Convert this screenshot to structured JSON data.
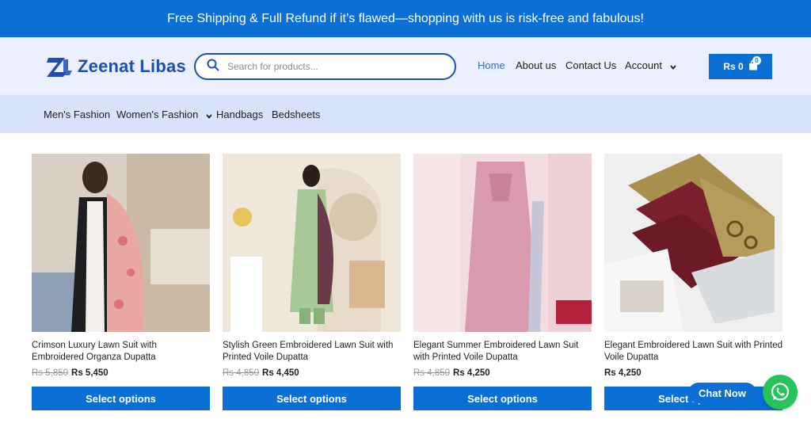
{
  "announcement": "Free Shipping & Full Refund if it’s flawed—shopping with us is risk-free and fabulous!",
  "brand": {
    "name": "Zeenat Libas",
    "color": "#1b4fb5",
    "icon": "zl-logo-icon"
  },
  "search": {
    "placeholder": "Search for products...",
    "value": ""
  },
  "nav": {
    "home": "Home",
    "about": "About us",
    "contact": "Contact Us",
    "account": "Account"
  },
  "cart": {
    "total": "Rs 0",
    "count": "0"
  },
  "categories": {
    "mens": "Men's Fashion",
    "womens": "Women's Fashion",
    "handbags": "Handbags",
    "bedsheets": "Bedsheets"
  },
  "products": [
    {
      "title": "Crimson Luxury Lawn Suit with Embroidered Organza Dupatta",
      "old_price": "Rs 5,850",
      "price": "Rs 5,450",
      "button": "Select options"
    },
    {
      "title": "Stylish Green Embroidered Lawn Suit with Printed Voile Dupatta",
      "old_price": "Rs 4,850",
      "price": "Rs 4,450",
      "button": "Select options"
    },
    {
      "title": "Elegant Summer Embroidered Lawn Suit with Printed Voile Dupatta",
      "old_price": "Rs 4,850",
      "price": "Rs 4,250",
      "button": "Select options"
    },
    {
      "title": "Elegant Embroidered Lawn Suit with Printed Voile Dupatta",
      "old_price": "",
      "price": "Rs 4,250",
      "button": "Select options"
    }
  ],
  "chat": {
    "label": "Chat Now",
    "icon": "whatsapp-icon"
  },
  "colors": {
    "primary": "#0b6fd6",
    "header_bg": "#eceffd",
    "category_bg": "#d8e3fb",
    "whatsapp": "#25c35a"
  }
}
